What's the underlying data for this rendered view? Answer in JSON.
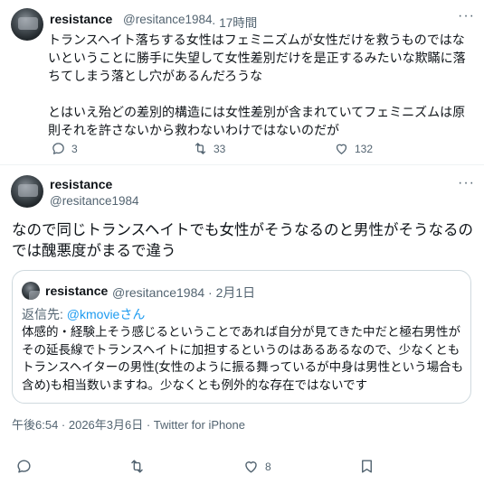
{
  "tweet1": {
    "author_name": "resistance",
    "handle": "@resitance1984",
    "time": "· 17時間",
    "text": "トランスヘイト落ちする女性はフェミニズムが女性だけを救うものではないということに勝手に失望して女性差別だけを是正するみたいな欺瞞に落ちてしまう落とし穴があるんだろうな\n\nとはいえ殆どの差別的構造には女性差別が含まれていてフェミニズムは原則それを許さないから救わないわけではないのだが",
    "replies": "3",
    "retweets": "33",
    "likes": "132",
    "more_label": "···"
  },
  "tweet2": {
    "author_name": "resistance",
    "handle": "@resitance1984",
    "more_label": "···",
    "text": "なので同じトランスヘイトでも女性がそうなるのと男性がそうなるのでは醜悪度がまるで違う",
    "timestamp": "午後6:54 · 2026年3月6日 · Twitter for iPhone",
    "likes": "8"
  },
  "quoted": {
    "author_name": "resistance",
    "meta": "@resitance1984 · 2月1日",
    "reply_prefix": "返信先: ",
    "reply_handle": "@kmovieさん",
    "text": "体感的・経験上そう感じるということであれば自分が見てきた中だと極右男性がその延長線でトランスヘイトに加担するというのはあるあるなので、少なくともトランスヘイターの男性(女性のように振る舞っているが中身は男性という場合も含め)も相当数いますね。少なくとも例外的な存在ではないです"
  }
}
